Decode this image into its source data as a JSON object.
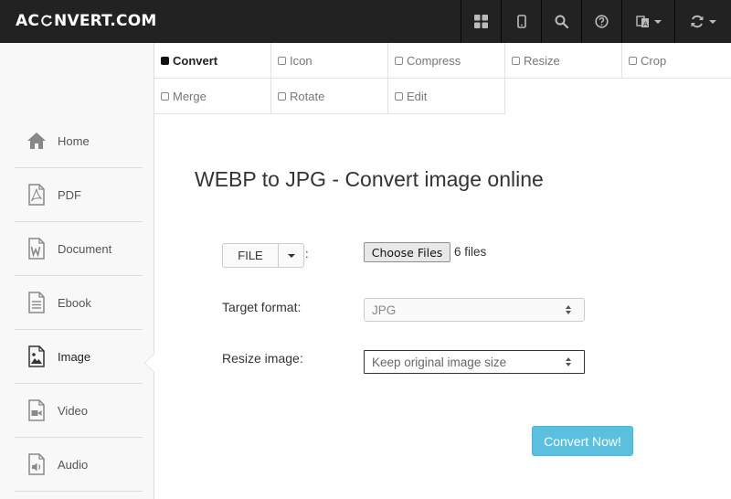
{
  "brand": {
    "part1": "AC",
    "part2": "NVERT.COM"
  },
  "tabs": [
    {
      "label": "Convert",
      "active": true
    },
    {
      "label": "Icon",
      "active": false
    },
    {
      "label": "Compress",
      "active": false
    },
    {
      "label": "Resize",
      "active": false
    },
    {
      "label": "Crop",
      "active": false
    },
    {
      "label": "Merge",
      "active": false
    },
    {
      "label": "Rotate",
      "active": false
    },
    {
      "label": "Edit",
      "active": false
    }
  ],
  "sidebar": {
    "items": [
      {
        "label": "Home",
        "icon": "home-icon"
      },
      {
        "label": "PDF",
        "icon": "pdf-file-icon"
      },
      {
        "label": "Document",
        "icon": "word-document-icon"
      },
      {
        "label": "Ebook",
        "icon": "ebook-file-icon"
      },
      {
        "label": "Image",
        "icon": "image-file-icon",
        "active": true
      },
      {
        "label": "Video",
        "icon": "video-file-icon"
      },
      {
        "label": "Audio",
        "icon": "audio-file-icon"
      }
    ]
  },
  "main": {
    "title": "WEBP to JPG - Convert image online",
    "source_button": "FILE",
    "colon": ":",
    "choose_files": "Choose Files",
    "files_count": "6 files",
    "target_format_label": "Target format:",
    "target_format_value": "JPG",
    "resize_label": "Resize image:",
    "resize_value": "Keep original image size",
    "convert_button": "Convert Now!"
  },
  "colors": {
    "navbar": "#222222",
    "accent": "#5bc0de"
  }
}
